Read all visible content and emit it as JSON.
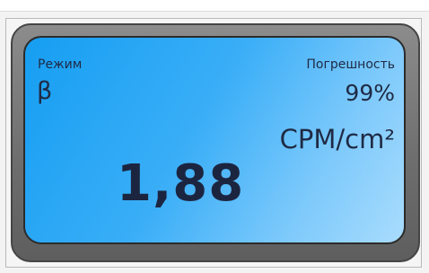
{
  "display": {
    "mode_label": "Режим",
    "mode_value": "β",
    "error_label": "Погрешность",
    "error_value": "99%",
    "unit": "CPM/cm²",
    "reading": "1,88"
  },
  "colors": {
    "screen_gradient_start": "#169ef2",
    "screen_gradient_end": "#a9dcfd",
    "bezel": "#6f6f6f",
    "text": "#1f2a44"
  }
}
